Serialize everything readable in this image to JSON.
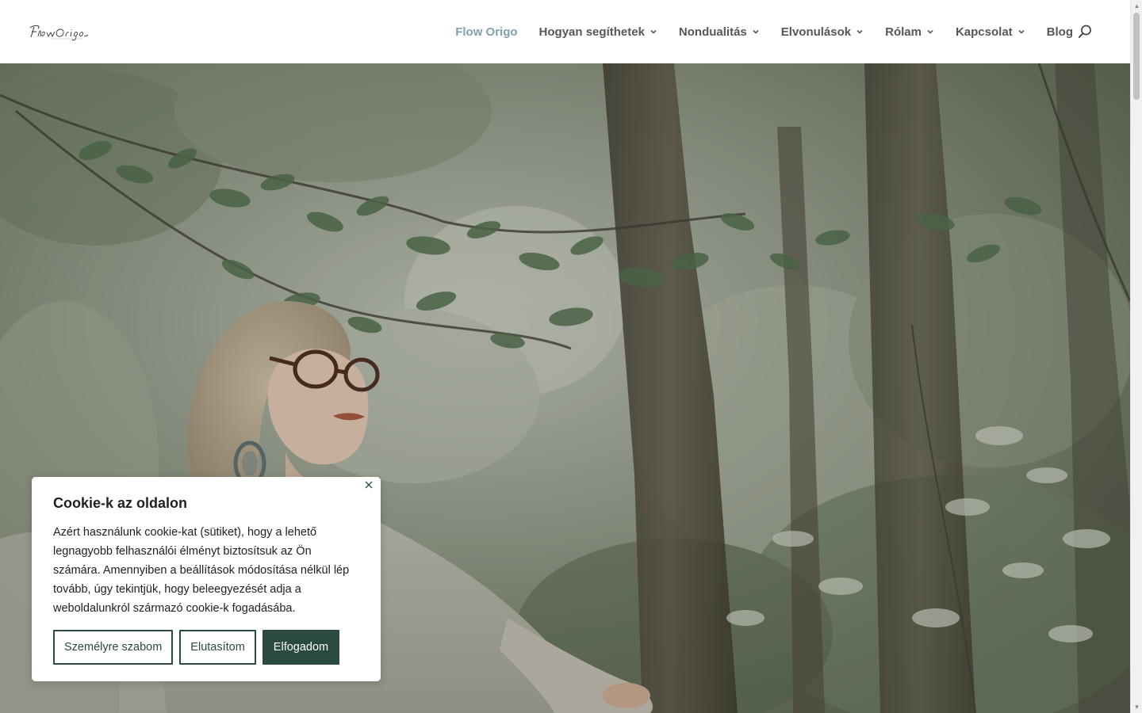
{
  "header": {
    "logo_text": "Flow Origo",
    "nav": [
      {
        "label": "Flow Origo",
        "active": true,
        "dropdown": false
      },
      {
        "label": "Hogyan segíthetek",
        "active": false,
        "dropdown": true
      },
      {
        "label": "Nondualitás",
        "active": false,
        "dropdown": true
      },
      {
        "label": "Elvonulások",
        "active": false,
        "dropdown": true
      },
      {
        "label": "Rólam",
        "active": false,
        "dropdown": true
      },
      {
        "label": "Kapcsolat",
        "active": false,
        "dropdown": true
      },
      {
        "label": "Blog",
        "active": false,
        "dropdown": false
      }
    ],
    "search_icon": "search-icon"
  },
  "cookie": {
    "title": "Cookie-k az oldalon",
    "text": "Azért használunk cookie-kat (sütiket), hogy a lehető legnagyobb felhasználói élményt biztosítsuk az Ön számára. Amennyiben a beállítások módosítása nélkül lép tovább, úgy tekintjük, hogy beleegyezését adja a weboldalunkról származó cookie-k fogadásába.",
    "customize_label": "Személyre szabom",
    "reject_label": "Elutasítom",
    "accept_label": "Elfogadom"
  },
  "colors": {
    "accent": "#7fa3ad",
    "nav_text": "#575757",
    "button_green": "#2a4a3f"
  }
}
